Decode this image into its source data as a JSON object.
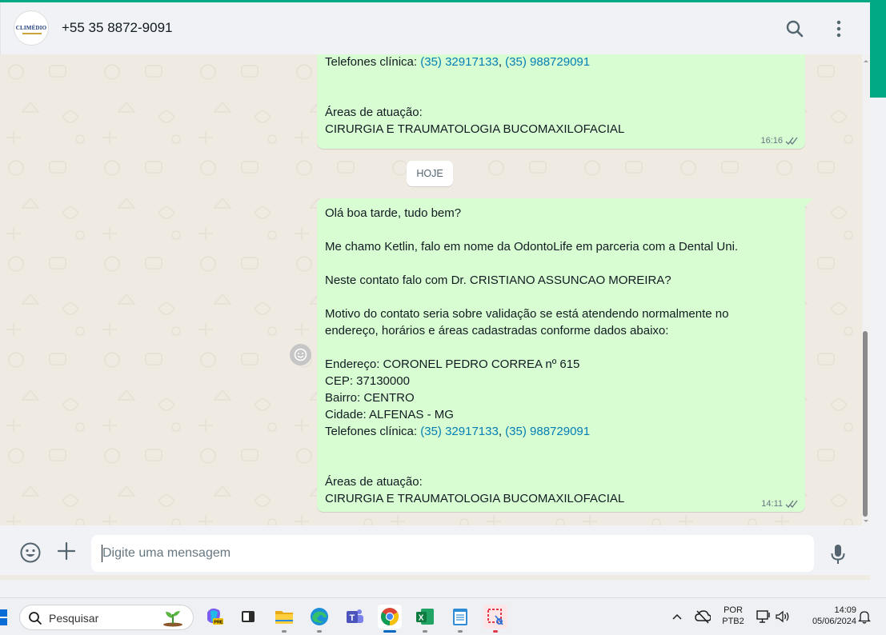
{
  "colors": {
    "accent": "#00a884",
    "bubble_out": "#d9fdd3",
    "link": "#027eb5",
    "chat_bg": "#efeae2"
  },
  "header": {
    "avatar_text": "CLIMÉDIO",
    "contact_name": "+55 35 8872-9091",
    "search_icon": "search-icon",
    "menu_icon": "kebab-menu-icon"
  },
  "messages": {
    "first": {
      "phones_label": "Telefones clínica: ",
      "phone_1": "(35) 32917133",
      "separator": ", ",
      "phone_2": "(35) 988729091",
      "areas_label": "Áreas de atuação:",
      "areas_value": "CIRURGIA E TRAUMATOLOGIA BUCOMAXILOFACIAL",
      "time": "16:16",
      "status_icon": "double-check-icon"
    },
    "date_divider": "HOJE",
    "second": {
      "greeting": "Olá boa tarde, tudo bem?",
      "intro": "Me chamo Ketlin, falo em nome da OdontoLife em parceria com a Dental Uni.",
      "question": "Neste contato falo com Dr. CRISTIANO ASSUNCAO MOREIRA?",
      "reason_1": "Motivo do contato seria sobre validação se está atendendo normalmente no",
      "reason_2": "endereço, horários e áreas cadastradas conforme dados abaixo:",
      "address": "Endereço: CORONEL PEDRO CORREA nº 615",
      "cep": "CEP: 37130000",
      "district": "Bairro: CENTRO",
      "city": "Cidade: ALFENAS - MG",
      "phones_label": "Telefones clínica: ",
      "phone_1": "(35) 32917133",
      "separator": ", ",
      "phone_2": "(35) 988729091",
      "areas_label": "Áreas de atuação:",
      "areas_value": "CIRURGIA E TRAUMATOLOGIA BUCOMAXILOFACIAL",
      "time": "14:11",
      "status_icon": "double-check-icon"
    },
    "reaction_icon": "smiley-icon"
  },
  "composer": {
    "placeholder": "Digite uma mensagem",
    "emoji_icon": "emoji-icon",
    "attach_icon": "plus-icon",
    "mic_icon": "microphone-icon"
  },
  "taskbar": {
    "search_label": "Pesquisar",
    "apps": [
      "copilot",
      "task-view",
      "file-explorer",
      "edge",
      "teams",
      "chrome",
      "excel",
      "notepad",
      "snipping-tool"
    ],
    "active_app": "chrome",
    "language_1": "POR",
    "language_2": "PTB2",
    "time": "14:09",
    "date": "05/06/2024"
  }
}
